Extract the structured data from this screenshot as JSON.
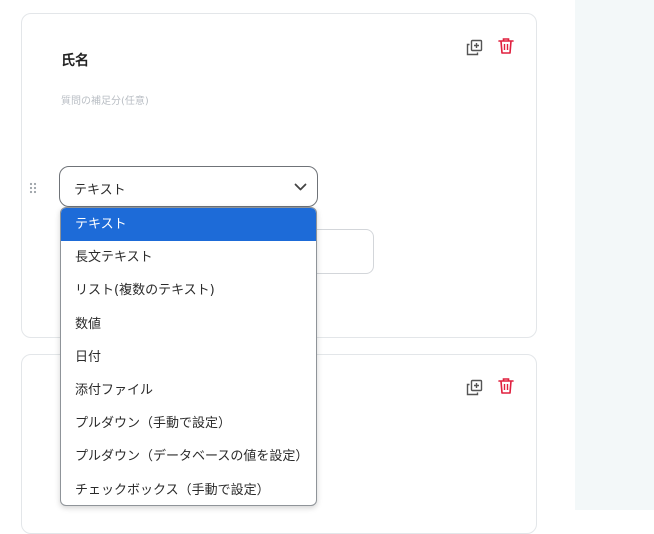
{
  "question": {
    "title": "氏名",
    "help_placeholder": "質問の補足分(任意)",
    "type_select": {
      "value": "テキスト",
      "options": [
        "テキスト",
        "長文テキスト",
        "リスト(複数のテキスト)",
        "数値",
        "日付",
        "添付ファイル",
        "プルダウン（手動で設定）",
        "プルダウン（データベースの値を設定）",
        "チェックボックス（手動で設定）"
      ],
      "selected_index": 0
    }
  },
  "icons": {
    "duplicate": "duplicate-icon",
    "delete": "trash-icon",
    "drag": "drag-handle-icon",
    "chevron": "chevron-down-icon"
  },
  "colors": {
    "accent": "#1d6bd8",
    "delete": "#e0203f",
    "side_panel": "#f3f8f9"
  }
}
